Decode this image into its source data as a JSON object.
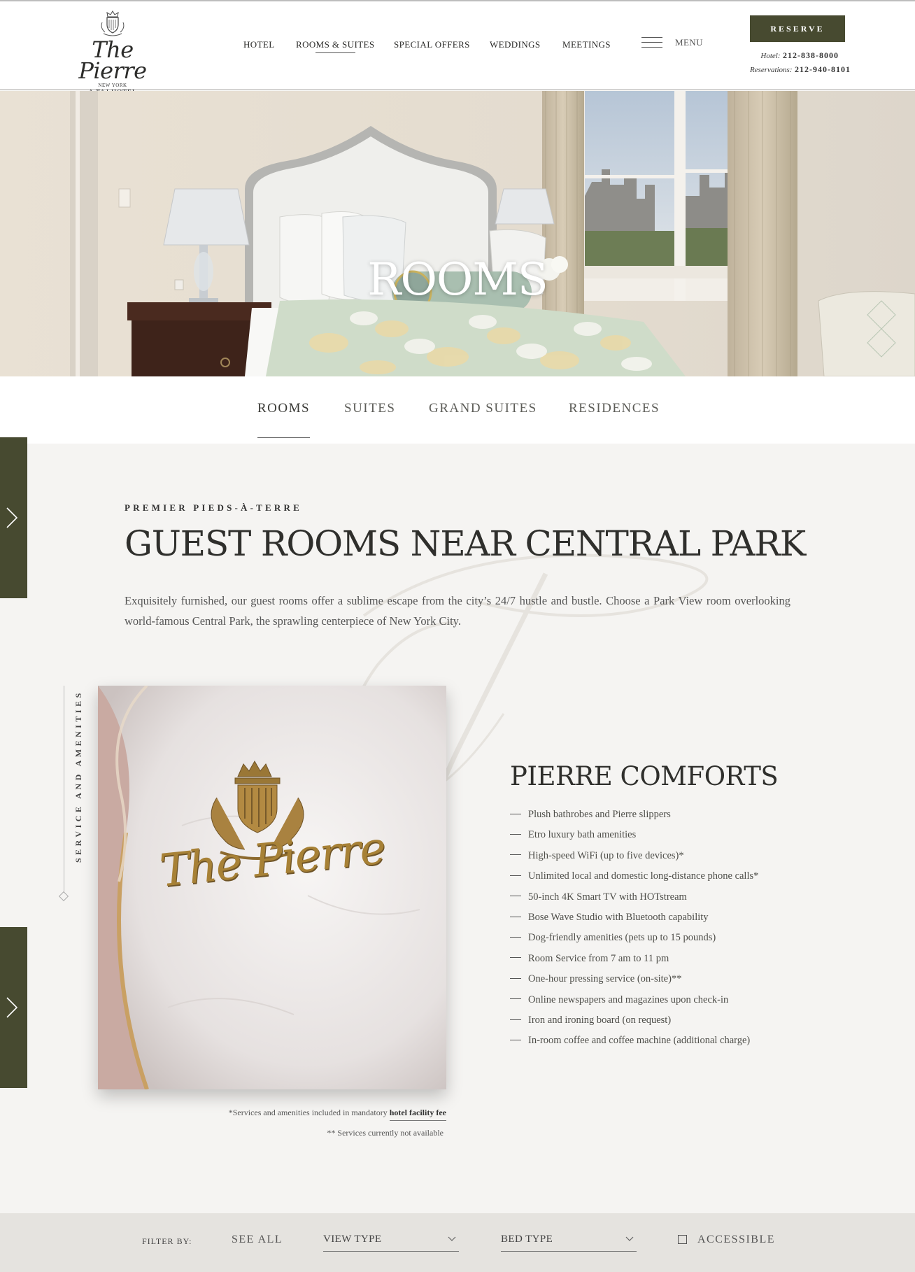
{
  "header": {
    "logo": {
      "name": "The Pierre",
      "city": "NEW YORK",
      "tagline": "A TAJ HOTEL"
    },
    "nav": [
      {
        "label": "HOTEL",
        "active": false
      },
      {
        "label": "ROOMS & SUITES",
        "active": true
      },
      {
        "label": "SPECIAL OFFERS",
        "active": false
      },
      {
        "label": "WEDDINGS",
        "active": false
      },
      {
        "label": "MEETINGS",
        "active": false
      }
    ],
    "menu_label": "MENU",
    "reserve_label": "RESERVE",
    "phone_hotel_label": "Hotel:",
    "phone_hotel": "212-838-8000",
    "phone_res_label": "Reservations:",
    "phone_res": "212-940-8101"
  },
  "hero": {
    "title": "ROOMS"
  },
  "tabs": [
    {
      "label": "ROOMS",
      "active": true
    },
    {
      "label": "SUITES",
      "active": false
    },
    {
      "label": "GRAND SUITES",
      "active": false
    },
    {
      "label": "RESIDENCES",
      "active": false
    }
  ],
  "intro": {
    "eyebrow": "PREMIER PIEDS-À-TERRE",
    "title": "GUEST ROOMS NEAR CENTRAL PARK",
    "body": "Exquisitely furnished, our guest rooms offer a sublime escape from the city’s 24/7 hustle and bustle. Choose a Park View room overlooking world-famous Central Park, the sprawling centerpiece of New York City."
  },
  "section_label": "SERVICE AND AMENITIES",
  "robe_embroidery": "The Pierre",
  "comforts": {
    "title": "PIERRE COMFORTS",
    "items": [
      "Plush bathrobes and Pierre slippers",
      "Etro luxury bath amenities",
      "High-speed WiFi (up to five devices)*",
      "Unlimited local and domestic long-distance phone calls*",
      "50-inch 4K Smart TV with HOTstream",
      "Bose Wave Studio with Bluetooth capability",
      "Dog-friendly amenities (pets up to 15 pounds)",
      "Room Service from 7 am to 11 pm",
      "One-hour pressing service (on-site)**",
      "Online newspapers and magazines upon check-in",
      "Iron and ironing board (on request)",
      "In-room coffee and coffee machine (additional charge)"
    ]
  },
  "notes": {
    "fee_prefix": "*Services and amenities included in mandatory",
    "fee_link": "hotel facility fee",
    "not_available": "** Services currently not available"
  },
  "filter": {
    "label": "FILTER BY:",
    "see_all": "SEE ALL",
    "view_type": "VIEW TYPE",
    "bed_type": "BED TYPE",
    "accessible": "ACCESSIBLE",
    "accessible_checked": false
  },
  "colors": {
    "brand_olive": "#474a30",
    "background": "#f5f4f2",
    "filter_bar": "#e5e3df"
  }
}
